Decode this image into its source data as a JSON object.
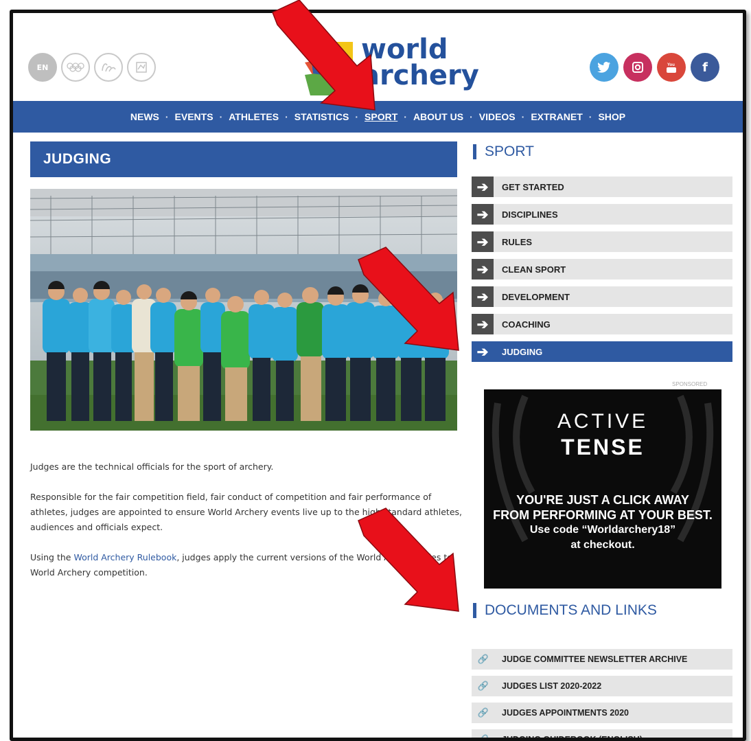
{
  "header": {
    "lang": "EN",
    "logo_line1": "world",
    "logo_line2": "archery",
    "social": [
      "twitter-icon",
      "instagram-icon",
      "youtube-icon",
      "facebook-icon"
    ]
  },
  "nav": {
    "items": [
      "NEWS",
      "EVENTS",
      "ATHLETES",
      "STATISTICS",
      "SPORT",
      "ABOUT US",
      "VIDEOS",
      "EXTRANET",
      "SHOP"
    ],
    "active": "SPORT"
  },
  "page": {
    "title": "JUDGING",
    "paragraph1": "Judges are the technical officials for the sport of archery.",
    "paragraph2": "Responsible for the fair competition field, fair conduct of competition and fair performance of athletes, judges are appointed to ensure World Archery events live up to the high standard athletes, audiences and officials expect.",
    "paragraph3_pre": "Using the ",
    "paragraph3_link": "World Archery Rulebook",
    "paragraph3_post": ", judges apply the current versions of the World Archery rules to World Archery competition."
  },
  "sidebar": {
    "title": "SPORT",
    "items": [
      {
        "label": "GET STARTED"
      },
      {
        "label": "DISCIPLINES"
      },
      {
        "label": "RULES"
      },
      {
        "label": "CLEAN SPORT"
      },
      {
        "label": "DEVELOPMENT"
      },
      {
        "label": "COACHING"
      },
      {
        "label": "JUDGING"
      }
    ],
    "active_index": 6,
    "sponsored": "SPONSORED"
  },
  "ad": {
    "brand1": "ACTIVE",
    "brand2": "TENSE",
    "line1": "YOU'RE JUST A CLICK AWAY",
    "line2": "FROM PERFORMING AT YOUR BEST.",
    "line3": "Use code “Worldarchery18”",
    "line4": "at checkout."
  },
  "documents": {
    "title": "DOCUMENTS AND LINKS",
    "items": [
      {
        "label": "JUDGE COMMITTEE NEWSLETTER ARCHIVE"
      },
      {
        "label": "JUDGES LIST 2020-2022"
      },
      {
        "label": "JUDGES APPOINTMENTS 2020"
      },
      {
        "label": "JUDGING GUIDEBOOK (ENGLISH)"
      }
    ]
  },
  "colors": {
    "brand_blue": "#2f5aa2",
    "arrow_red": "#e8101a"
  }
}
